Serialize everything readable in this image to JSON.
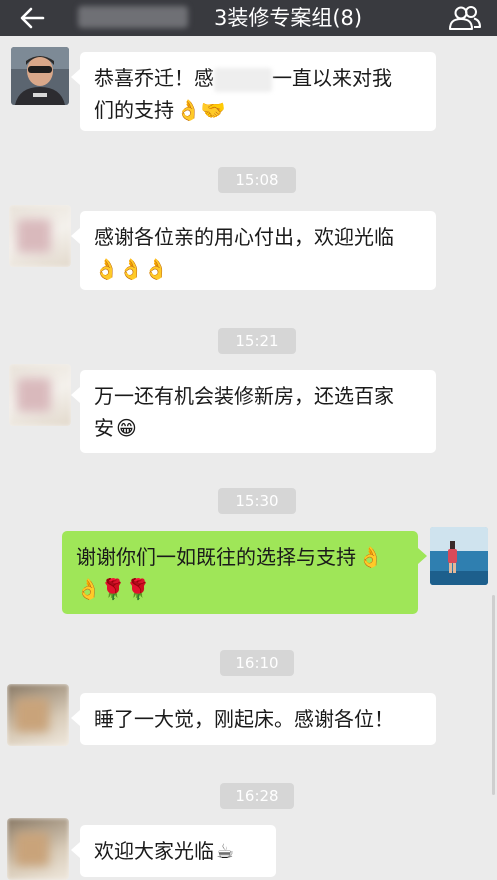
{
  "header": {
    "title": "3装修专案组(8)"
  },
  "messages": [
    {
      "side": "left",
      "line1_part1": "恭喜乔迁！感",
      "line1_part2": "一直以来对我",
      "line2": "们的支持",
      "emoji": "👌🤝"
    },
    {
      "side": "left",
      "line1": "感谢各位亲的用心付出，欢迎光临",
      "line2_emoji": "👌👌👌"
    },
    {
      "side": "left",
      "line1": "万一还有机会装修新房，还选百家",
      "line2": "安",
      "emoji": "😁"
    },
    {
      "side": "right",
      "line1": "谢谢你们一如既往的选择与支持",
      "line1_emoji": "👌",
      "line2_emoji": "👌🌹🌹"
    },
    {
      "side": "left",
      "line1": "睡了一大觉，刚起床。感谢各位！"
    },
    {
      "side": "left",
      "line1": "欢迎大家光临",
      "emoji": "☕"
    }
  ],
  "timestamps": [
    "15:08",
    "15:21",
    "15:30",
    "16:10",
    "16:28"
  ],
  "colors": {
    "topbar": "#393a3f",
    "background": "#ebebeb",
    "incoming_bubble": "#ffffff",
    "outgoing_bubble": "#9fe658",
    "timestamp_bg": "#d6d6d6"
  },
  "icons": {
    "back": "back-arrow-icon",
    "members": "group-members-icon"
  }
}
